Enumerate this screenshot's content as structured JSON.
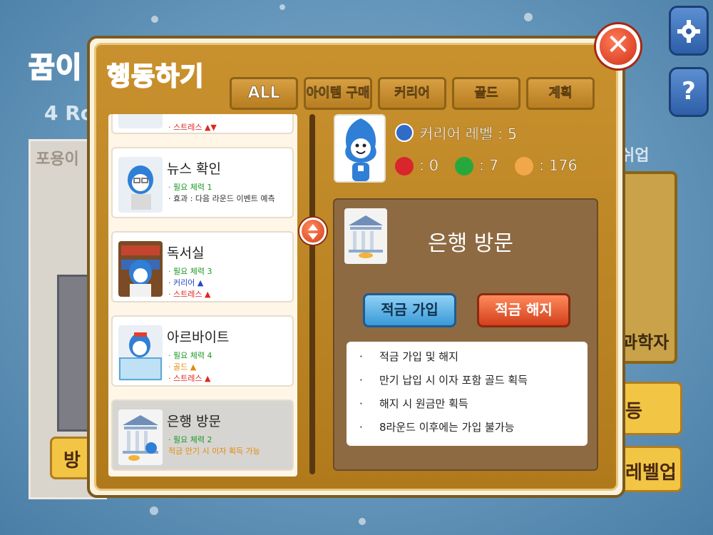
{
  "background": {
    "title": "꿈이",
    "round": "4 Ro",
    "room_label": "포용이",
    "left_button": "방",
    "right_top_label": "쉬업",
    "right_panel_label": "과학자",
    "right_button_1": "등",
    "right_button_2": "레벨업"
  },
  "top_right": {
    "settings_icon": "gear-icon",
    "help_label": "?"
  },
  "dialog": {
    "title": "행동하기",
    "close_label": "✕",
    "tabs": [
      {
        "label": "ALL"
      },
      {
        "label": "아이템 구매"
      },
      {
        "label": "커리어"
      },
      {
        "label": "골드"
      },
      {
        "label": "계획"
      }
    ]
  },
  "actions": [
    {
      "title": "",
      "lines": [
        {
          "text": "· 스트레스 ▲▼"
        }
      ]
    },
    {
      "title": "뉴스 확인",
      "lines": [
        {
          "text": "· 필요 체력 1"
        },
        {
          "text": "· 효과 : 다음 라운드 이벤트 예측"
        }
      ]
    },
    {
      "title": "독서실",
      "lines": [
        {
          "text": "· 필요 체력 3"
        },
        {
          "text": "· 커리어 ▲"
        },
        {
          "text": "· 스트레스 ▲"
        }
      ]
    },
    {
      "title": "아르바이트",
      "lines": [
        {
          "text": "· 필요 체력 4"
        },
        {
          "text": "· 골드 ▲"
        },
        {
          "text": "· 스트레스 ▲"
        }
      ]
    },
    {
      "title": "은행 방문",
      "lines": [
        {
          "text": "· 필요 체력 2"
        },
        {
          "text": "적금 만기 시 이자 획득 가능"
        }
      ]
    }
  ],
  "status": {
    "career_level": "커리어 레벨 : 5",
    "stress": ": 0",
    "stamina": ": 7",
    "gold": ": 176"
  },
  "detail": {
    "title": "은행 방문",
    "join_button": "적금 가입",
    "cancel_button": "적금 해지",
    "bullet": "·",
    "description": [
      "적금 가입 및 해지",
      "만기 납입 시 이자 포함 골드 획득",
      "해지 시 원금만 획득",
      "8라운드 이후에는 가입 불가능"
    ]
  },
  "colors": {
    "accent_blue": "#2a4fa0",
    "panel_gold": "#c9912e",
    "close_red": "#d0301a",
    "positive_green": "#1c9a26",
    "career_blue": "#2548c8",
    "stress_red": "#e0271f",
    "gold_orange": "#e28a0f"
  }
}
